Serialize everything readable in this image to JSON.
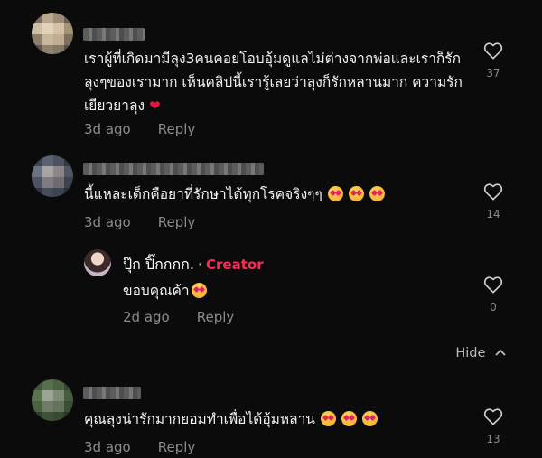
{
  "comments": [
    {
      "text": "เราผู้ที่เกิดมามีลุง3คนคอยโอบอุ้มดูแลไม่ต่างจากพ่อและเราก็รักลุงๆของเรามาก เห็นคลิปนี้เรารู้เลยว่าลุงก็รักหลานมาก ความรักเยียวยาลุง",
      "time": "3d ago",
      "reply": "Reply",
      "likes": "37"
    },
    {
      "text": "นี้แหละเด็กคือยาที่รักษาได้ทุกโรคจริงๆๆ",
      "time": "3d ago",
      "reply": "Reply",
      "likes": "14"
    },
    {
      "author": "ปุ๊ก ปิ๊กกกก.",
      "badge": "Creator",
      "text": "ขอบคุณค้า",
      "time": "2d ago",
      "reply": "Reply",
      "likes": "0"
    },
    {
      "text": "คุณลุงน่ารักมากยอมทำเพื่อได้อุ้มหลาน",
      "time": "3d ago",
      "reply": "Reply",
      "likes": "13"
    }
  ],
  "hide_label": "Hide",
  "icons": {
    "like": "heart-outline-icon",
    "red_heart": "red-heart-emoji",
    "emoji": "heart-eyes-emoji",
    "hide": "chevron-up-icon"
  },
  "colors": {
    "background": "#0b0b0b",
    "creator_badge": "#fe2c55",
    "muted": "#8c8c8c"
  }
}
